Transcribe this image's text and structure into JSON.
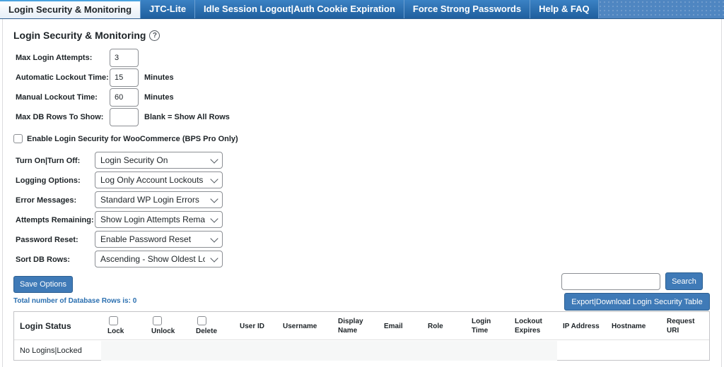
{
  "tabs": [
    {
      "label": "Login Security & Monitoring",
      "active": true
    },
    {
      "label": "JTC-Lite",
      "active": false
    },
    {
      "label": "Idle Session Logout|Auth Cookie Expiration",
      "active": false
    },
    {
      "label": "Force Strong Passwords",
      "active": false
    },
    {
      "label": "Help & FAQ",
      "active": false
    }
  ],
  "section": {
    "title": "Login Security & Monitoring",
    "help_icon": "question-circle-icon"
  },
  "fields": {
    "max_login_attempts": {
      "label": "Max Login Attempts:",
      "value": "3"
    },
    "auto_lockout": {
      "label": "Automatic Lockout Time:",
      "value": "15",
      "unit": "Minutes"
    },
    "manual_lockout": {
      "label": "Manual Lockout Time:",
      "value": "60",
      "unit": "Minutes"
    },
    "max_db_rows": {
      "label": "Max DB Rows To Show:",
      "value": "",
      "unit": "Blank = Show All Rows"
    }
  },
  "woocommerce": {
    "label": "Enable Login Security for WooCommerce (BPS Pro Only)",
    "checked": false
  },
  "selects": {
    "turn_on_off": {
      "label": "Turn On|Turn Off:",
      "value": "Login Security On"
    },
    "logging": {
      "label": "Logging Options:",
      "value": "Log Only Account Lockouts"
    },
    "errors": {
      "label": "Error Messages:",
      "value": "Standard WP Login Errors"
    },
    "attempts": {
      "label": "Attempts Remaining:",
      "value": "Show Login Attempts Remaining"
    },
    "password_reset": {
      "label": "Password Reset:",
      "value": "Enable Password Reset"
    },
    "sort_rows": {
      "label": "Sort DB Rows:",
      "value": "Ascending - Show Oldest Login Bans"
    }
  },
  "buttons": {
    "save": "Save Options",
    "search": "Search",
    "export": "Export|Download Login Security Table"
  },
  "search": {
    "value": ""
  },
  "total_rows": "Total number of Database Rows is: 0",
  "table": {
    "headers": {
      "status": "Login Status",
      "lock": "Lock",
      "unlock": "Unlock",
      "delete": "Delete",
      "user_id": "User ID",
      "username": "Username",
      "display_name": "Display\nName",
      "email": "Email",
      "role": "Role",
      "login_time": "Login\nTime",
      "lockout_expires": "Lockout\nExpires",
      "ip_address": "IP Address",
      "hostname": "Hostname",
      "request_uri": "Request\nURI"
    },
    "rows": [
      {
        "status": "No Logins|Locked"
      }
    ]
  },
  "colors": {
    "tab_bar": "#4f86c1",
    "button": "#3f7ab7",
    "link_text": "#2a6fb0"
  }
}
